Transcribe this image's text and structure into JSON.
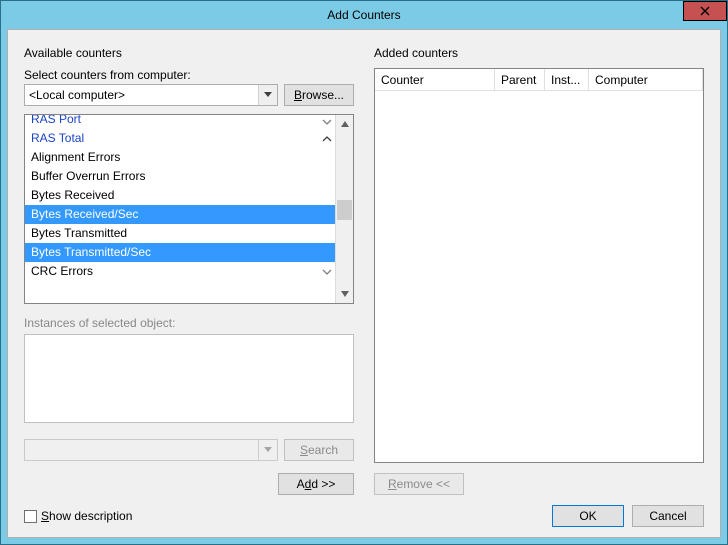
{
  "window": {
    "title": "Add Counters"
  },
  "left": {
    "group_title": "Available counters",
    "select_label": "Select counters from computer:",
    "computer_value": "<Local computer>",
    "browse_label": "Browse...",
    "browse_mnemonic": "B",
    "categories": {
      "ras_port": "RAS Port",
      "ras_total": "RAS Total"
    },
    "ras_total_children": [
      "Alignment Errors",
      "Buffer Overrun Errors",
      "Bytes Received",
      "Bytes Received/Sec",
      "Bytes Transmitted",
      "Bytes Transmitted/Sec",
      "CRC Errors"
    ],
    "instances_label": "Instances of selected object:",
    "search_label": "Search",
    "search_mnemonic": "S",
    "add_label": "Add >>",
    "add_mnemonic": "d"
  },
  "right": {
    "group_title": "Added counters",
    "columns": {
      "counter": "Counter",
      "parent": "Parent",
      "instance": "Inst...",
      "computer": "Computer"
    },
    "remove_label": "Remove <<",
    "remove_mnemonic": "R"
  },
  "footer": {
    "show_desc_label": "Show description",
    "show_desc_mnemonic": "S",
    "ok_label": "OK",
    "cancel_label": "Cancel"
  }
}
